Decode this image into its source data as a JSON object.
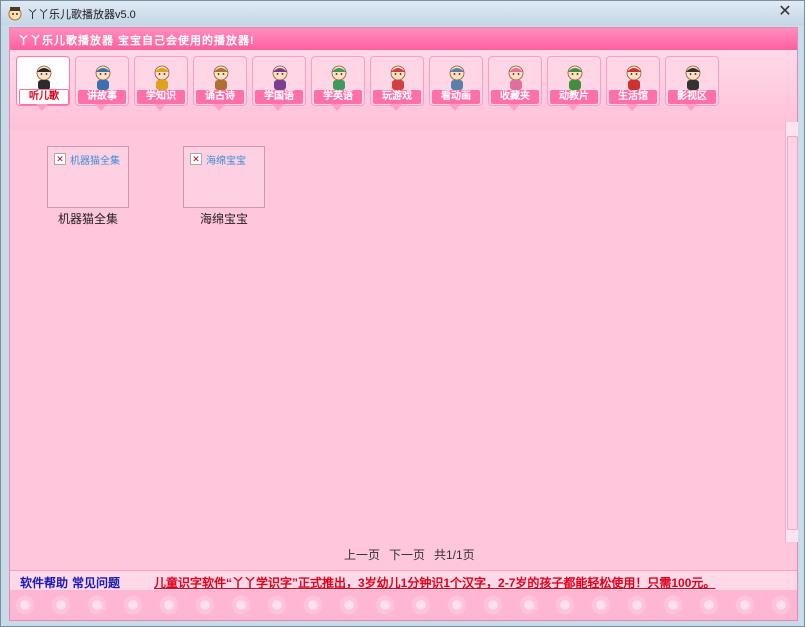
{
  "window": {
    "title": "丫丫乐儿歌播放器v5.0"
  },
  "banner": {
    "text": "丫丫乐儿歌播放器  宝宝自己会使用的播放器!"
  },
  "nav": {
    "items": [
      {
        "label": "听儿歌",
        "icon": "listen-song-icon",
        "active": true
      },
      {
        "label": "讲故事",
        "icon": "tell-story-icon",
        "active": false
      },
      {
        "label": "学知识",
        "icon": "learn-knowledge-icon",
        "active": false
      },
      {
        "label": "诵古诗",
        "icon": "recite-poem-icon",
        "active": false
      },
      {
        "label": "学国语",
        "icon": "learn-mandarin-icon",
        "active": false
      },
      {
        "label": "学英语",
        "icon": "learn-english-icon",
        "active": false
      },
      {
        "label": "玩游戏",
        "icon": "play-game-icon",
        "active": false
      },
      {
        "label": "看动画",
        "icon": "watch-cartoon-icon",
        "active": false
      },
      {
        "label": "收藏夹",
        "icon": "favorites-icon",
        "active": false
      },
      {
        "label": "动教片",
        "icon": "education-film-icon",
        "active": false
      },
      {
        "label": "生活馆",
        "icon": "watermelon-icon",
        "active": false
      },
      {
        "label": "影视区",
        "icon": "film-reel-icon",
        "active": false
      }
    ]
  },
  "albums": [
    {
      "thumb_alt": "机器猫全集",
      "caption": "机器猫全集"
    },
    {
      "thumb_alt": "海绵宝宝",
      "caption": "海绵宝宝"
    }
  ],
  "pager": {
    "prev": "上一页",
    "next": "下一页",
    "info": "共1/1页"
  },
  "footer": {
    "help": "软件帮助",
    "faq": "常见问题",
    "ad": "儿童识字软件“丫丫学识字”正式推出，3岁幼儿1分钟识1个汉字，2-7岁的孩子都能轻松使用！只需100元。"
  },
  "colors": {
    "background": "#ffc6dc",
    "banner": "#ff6fa8",
    "link": "#1a1ab8",
    "ad_text": "#e3001b"
  }
}
